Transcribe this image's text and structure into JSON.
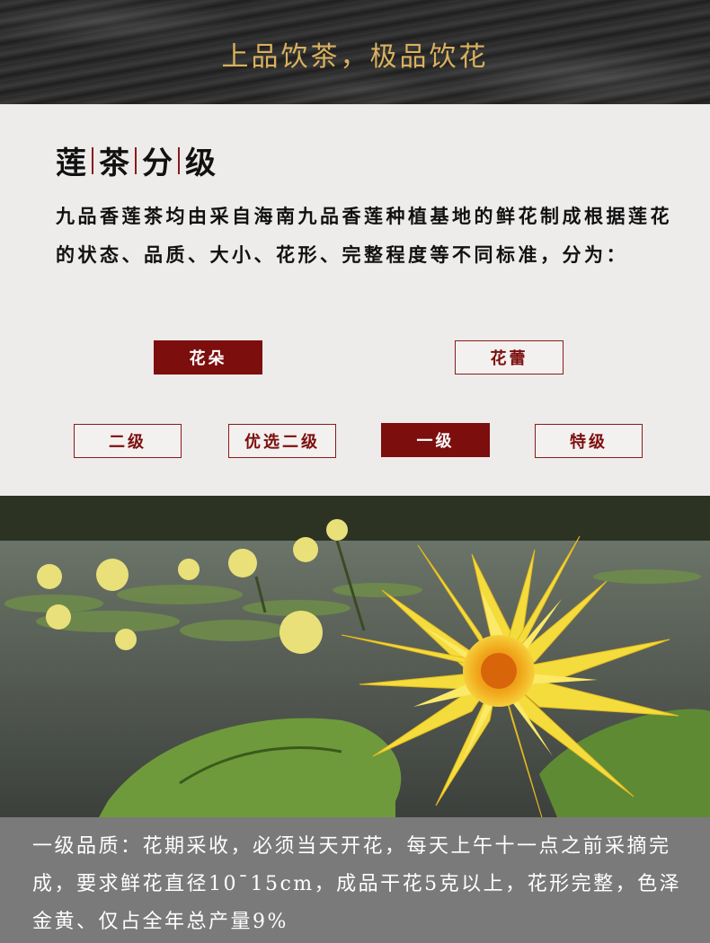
{
  "banner": {
    "title": "上品饮茶，极品饮花"
  },
  "section": {
    "title_chars": [
      "莲",
      "茶",
      "分",
      "级"
    ],
    "description": "九品香莲茶均由采自海南九品香莲种植基地的鲜花制成根据莲花的状态、品质、大小、花形、完整程度等不同标准，分为："
  },
  "category_buttons": {
    "flower": "花朵",
    "bud": "花蕾"
  },
  "grade_buttons": {
    "second": "二级",
    "premium_second": "优选二级",
    "first": "一级",
    "special": "特级"
  },
  "caption": {
    "text": "一级品质：花期采收，必须当天开花，每天上午十一点之前采摘完成，要求鲜花直径10ˉ15cm，成品干花5克以上，花形完整，色泽金黄、仅占全年总产量9%"
  },
  "colors": {
    "accent": "#7c0e0e",
    "banner_text": "#d9b15e",
    "panel_bg": "#eeecea",
    "caption_bg": "#7a7a7a"
  }
}
